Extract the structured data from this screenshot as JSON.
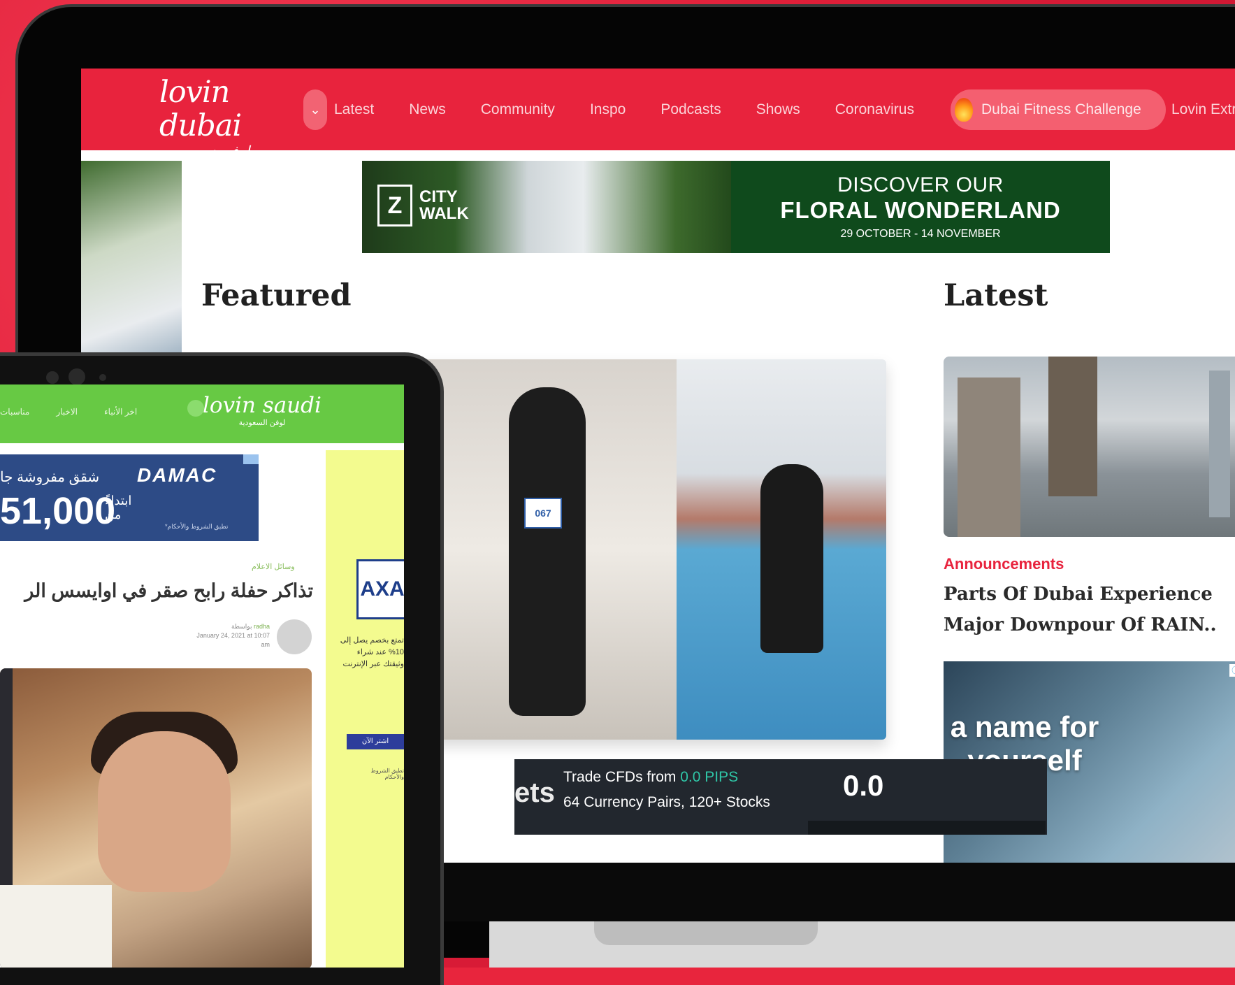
{
  "dubai_site": {
    "logo": {
      "main": "lovin dubai",
      "sub": "لوفن دبي"
    },
    "nav": {
      "items": [
        "Latest",
        "News",
        "Community",
        "Inspo",
        "Podcasts",
        "Shows",
        "Coronavirus"
      ],
      "highlight": "Dubai Fitness Challenge",
      "extra": "Lovin Extra"
    },
    "banner": {
      "brand": "CITY WALK",
      "line1": "DISCOVER OUR",
      "line2": "FLORAL WONDERLAND",
      "dates": "29 OCTOBER - 14 NOVEMBER"
    },
    "featured_heading": "Featured",
    "latest_heading": "Latest",
    "featured_bib": "067",
    "latest_card": {
      "category": "Announcements",
      "title": "Parts Of Dubai Experience Major Downpour Of RAIN.."
    },
    "name_ad": {
      "text": "a name for yourself",
      "badge": "ⓘ X"
    },
    "trade_ad": {
      "partial": "ets",
      "line1_prefix": "Trade CFDs from ",
      "line1_highlight": "0.0 PIPS",
      "line2": "64 Currency Pairs, 120+ Stocks",
      "big_number": "0.0"
    }
  },
  "saudi_site": {
    "logo": {
      "main": "lovin saudi",
      "sub": "لوفن السعودية"
    },
    "nav_items": [
      "مناسبات",
      "الاخبار",
      "اخر الأنباء"
    ],
    "damac_ad": {
      "brand": "DAMAC",
      "headline": "شقق مفروشة جا",
      "price": "51,000",
      "from": "ابتداءً من",
      "terms": "*تطبق الشروط والأحكام"
    },
    "article": {
      "category": "وسائل الاعلام",
      "title": "تذاكر حفلة رابح صقر في اوايسس الر",
      "author_prefix": "بواسطة",
      "author": "radha",
      "date": "January 24, 2021 at 10:07 am"
    },
    "axa_ad": {
      "brand": "AXA",
      "text": "تمتع بخصم يصل إلى 10% عند شراء وثيقتك عبر الإنترنت",
      "button": "اشتر الآن",
      "terms": "تطبق الشروط والأحكام"
    }
  },
  "colors": {
    "background": "#e8253d",
    "dubai_nav": "#e8233d",
    "saudi_nav": "#67c944",
    "accent_red": "#e8233d"
  }
}
